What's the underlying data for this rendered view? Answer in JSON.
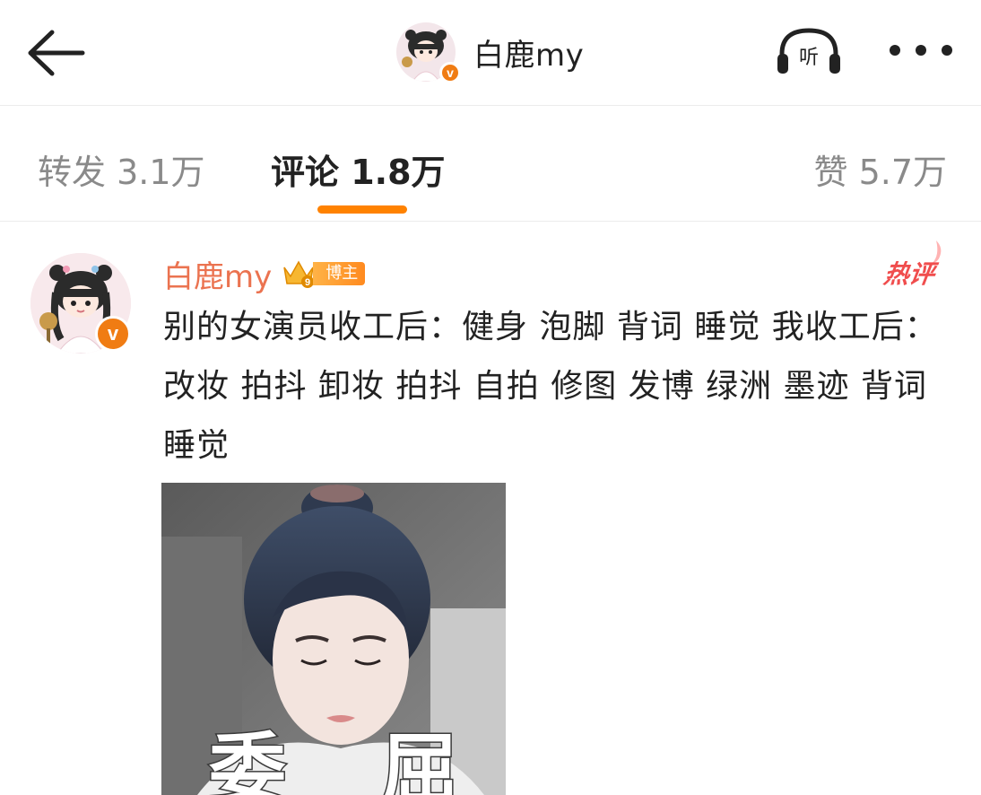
{
  "header": {
    "title": "白鹿my",
    "listen_label": "听"
  },
  "tabs": {
    "repost": "转发 3.1万",
    "comment": "评论 1.8万",
    "like": "赞 5.7万"
  },
  "comment": {
    "author": "白鹿my",
    "badge": "博主",
    "crown_level": "9",
    "verified_mark": "v",
    "hot_tag": "热评",
    "text": "别的女演员收工后：健身 泡脚 背词 睡觉 我收工后：改妆 拍抖 卸妆 拍抖 自拍 修图 发博 绿洲 墨迹 背词 睡觉",
    "image_caption_left": "委",
    "image_caption_right": "屈"
  },
  "colors": {
    "accent": "#ff8200",
    "author_name": "#eb7350",
    "verified": "#f07c13",
    "hot": "#f04d4d"
  },
  "icons": {
    "back": "arrow-left-icon",
    "listen": "headphones-icon",
    "more": "more-dots-icon"
  }
}
